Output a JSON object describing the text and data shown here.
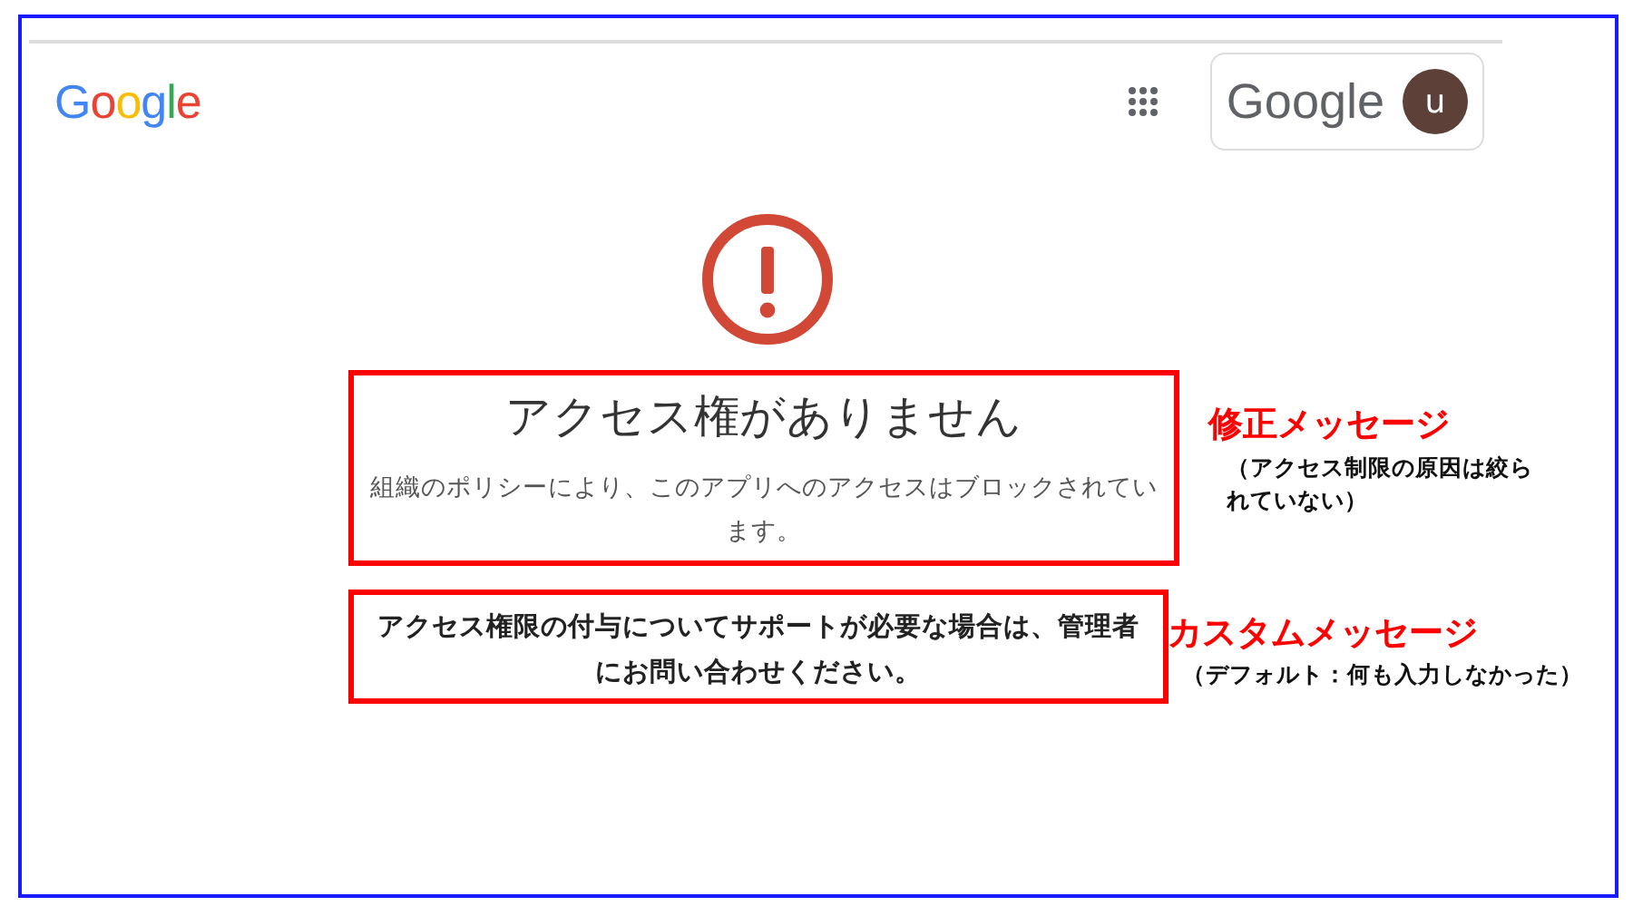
{
  "header": {
    "logo": "Google",
    "account_chip": {
      "brand": "Google",
      "avatar_letter": "u"
    }
  },
  "error": {
    "title": "アクセス権がありません",
    "description": "組織のポリシーにより、このアプリへのアクセスはブロックされています。",
    "help": "アクセス権限の付与についてサポートが必要な場合は、管理者にお問い合わせください。"
  },
  "annotations": [
    {
      "heading": "修正メッセージ",
      "note": "（アクセス制限の原因は絞られていない）"
    },
    {
      "heading": "カスタムメッセージ",
      "note": "（デフォルト：何も入力しなかった）"
    }
  ]
}
